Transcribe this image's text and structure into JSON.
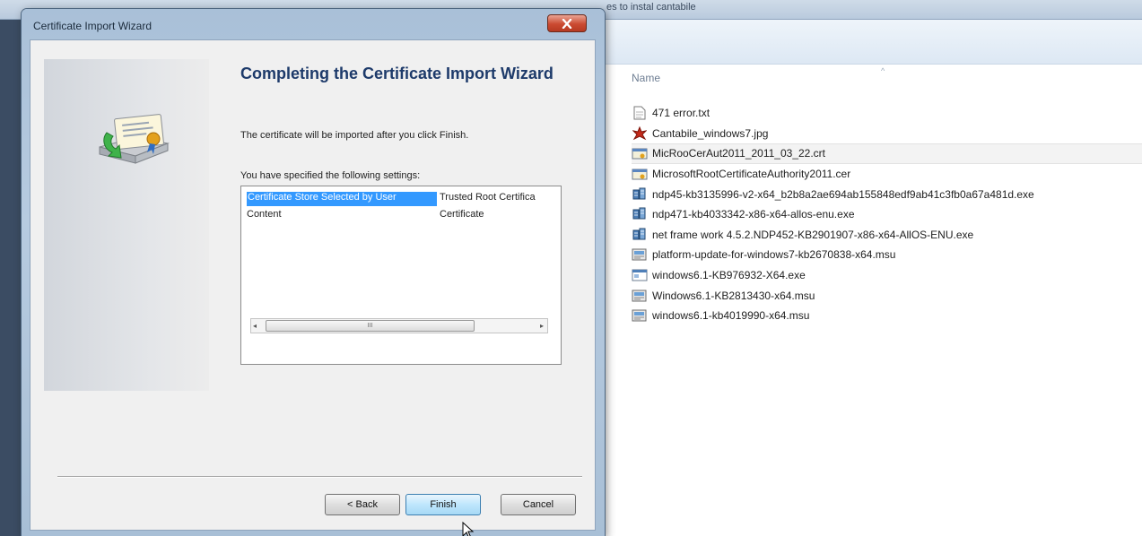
{
  "explorer": {
    "breadcrumb_tail": "es to instal cantabile",
    "column_header": "Name",
    "sort_indicator": "^",
    "files": [
      {
        "name": "471 error.txt",
        "icon": "text-file-icon"
      },
      {
        "name": "Cantabile_windows7.jpg",
        "icon": "image-file-icon"
      },
      {
        "name": "MicRooCerAut2011_2011_03_22.crt",
        "icon": "certificate-file-icon",
        "selected": true
      },
      {
        "name": "MicrosoftRootCertificateAuthority2011.cer",
        "icon": "certificate-file-icon"
      },
      {
        "name": "ndp45-kb3135996-v2-x64_b2b8a2ae694ab155848edf9ab41c3fb0a67a481d.exe",
        "icon": "installer-icon"
      },
      {
        "name": "ndp471-kb4033342-x86-x64-allos-enu.exe",
        "icon": "installer-icon"
      },
      {
        "name": "net frame work 4.5.2.NDP452-KB2901907-x86-x64-AllOS-ENU.exe",
        "icon": "installer-icon"
      },
      {
        "name": "platform-update-for-windows7-kb2670838-x64.msu",
        "icon": "update-package-icon"
      },
      {
        "name": "windows6.1-KB976932-X64.exe",
        "icon": "exe-file-icon"
      },
      {
        "name": "Windows6.1-KB2813430-x64.msu",
        "icon": "update-package-icon"
      },
      {
        "name": "windows6.1-kb4019990-x64.msu",
        "icon": "update-package-icon"
      }
    ]
  },
  "dialog": {
    "title": "Certificate Import Wizard",
    "close_glyph": "x",
    "heading": "Completing the Certificate Import Wizard",
    "intro": "The certificate will be imported after you click Finish.",
    "settings_label": "You have specified the following settings:",
    "settings": [
      {
        "key": "Certificate Store Selected by User",
        "value": "Trusted Root Certifica",
        "selected": true
      },
      {
        "key": "Content",
        "value": "Certificate"
      }
    ],
    "scroll_left": "◂",
    "scroll_right": "▸",
    "scroll_thumb": "III",
    "buttons": {
      "back": "< Back",
      "finish": "Finish",
      "cancel": "Cancel"
    }
  },
  "colors": {
    "selection": "#3399ff",
    "heading": "#1d3a6a",
    "close": "#cb4a31"
  }
}
